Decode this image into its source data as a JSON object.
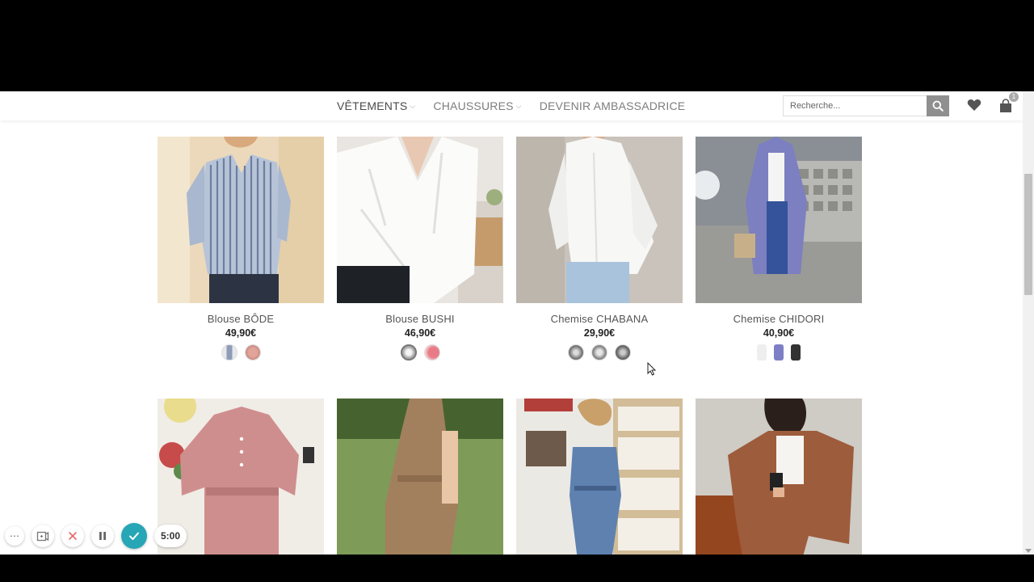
{
  "nav": {
    "items": [
      {
        "label": "VÊTEMENTS",
        "dropdown": true
      },
      {
        "label": "CHAUSSURES",
        "dropdown": true
      },
      {
        "label": "DEVENIR AMBASSADRICE",
        "dropdown": false
      }
    ]
  },
  "search": {
    "placeholder": "Recherche..."
  },
  "cart": {
    "count": "1"
  },
  "products": [
    {
      "name": "Blouse BÔDE",
      "price": "49,90€"
    },
    {
      "name": "Blouse BUSHI",
      "price": "46,90€"
    },
    {
      "name": "Chemise CHABANA",
      "price": "29,90€"
    },
    {
      "name": "Chemise CHIDORI",
      "price": "40,90€"
    }
  ],
  "recorder": {
    "timer": "5:00"
  },
  "colors": {
    "accent": "#27a6b5",
    "search_button": "#8f8f8f"
  }
}
